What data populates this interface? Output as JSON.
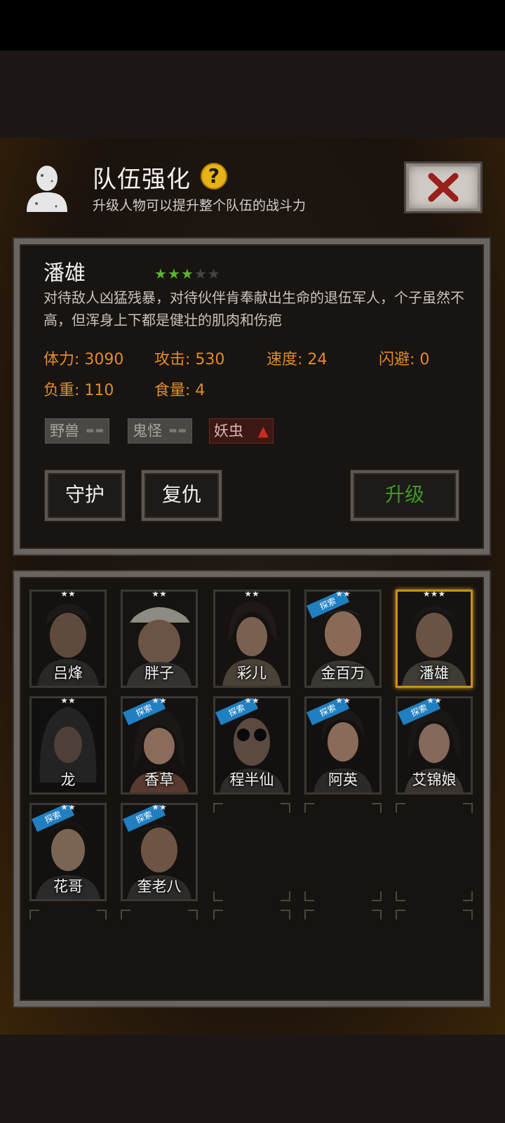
{
  "header": {
    "title": "队伍强化",
    "help_symbol": "?",
    "subtitle": "升级人物可以提升整个队伍的战斗力"
  },
  "selected": {
    "name": "潘雄",
    "stars": 3,
    "max_stars": 5,
    "description": "对待敌人凶猛残暴，对待伙伴肯奉献出生命的退伍军人，个子虽然不高，但浑身上下都是健壮的肌肉和伤疤",
    "stats": {
      "stamina": "体力: 3090",
      "attack": "攻击: 530",
      "speed": "速度: 24",
      "dodge": "闪避: 0",
      "load": "负重: 110",
      "food": "食量: 4"
    },
    "tags": [
      {
        "label": "野兽",
        "state": "neutral"
      },
      {
        "label": "鬼怪",
        "state": "neutral"
      },
      {
        "label": "妖虫",
        "state": "up"
      }
    ],
    "actions": {
      "guard": "守护",
      "revenge": "复仇",
      "upgrade": "升级"
    }
  },
  "roster": [
    {
      "name": "吕烽",
      "stars": "★★",
      "explore": false,
      "selected": false
    },
    {
      "name": "胖子",
      "stars": "★★",
      "explore": false,
      "selected": false
    },
    {
      "name": "彩儿",
      "stars": "★★",
      "explore": false,
      "selected": false
    },
    {
      "name": "金百万",
      "stars": "★★",
      "explore": true,
      "selected": false
    },
    {
      "name": "潘雄",
      "stars": "★★★",
      "explore": false,
      "selected": true
    },
    {
      "name": "龙",
      "stars": "★★",
      "explore": false,
      "selected": false
    },
    {
      "name": "香草",
      "stars": "★★",
      "explore": true,
      "selected": false
    },
    {
      "name": "程半仙",
      "stars": "★★",
      "explore": true,
      "selected": false
    },
    {
      "name": "阿英",
      "stars": "★★",
      "explore": true,
      "selected": false
    },
    {
      "name": "艾锦娘",
      "stars": "★★",
      "explore": true,
      "selected": false
    },
    {
      "name": "花哥",
      "stars": "★★",
      "explore": true,
      "selected": false
    },
    {
      "name": "奎老八",
      "stars": "★★",
      "explore": true,
      "selected": false
    }
  ],
  "explore_badge": "探索",
  "colors": {
    "stat_orange": "#e08c2c",
    "upgrade_green": "#3a9a22",
    "star_green": "#58b52c",
    "selected_border": "#c8901a",
    "explore_blue": "#1f7fc0"
  }
}
